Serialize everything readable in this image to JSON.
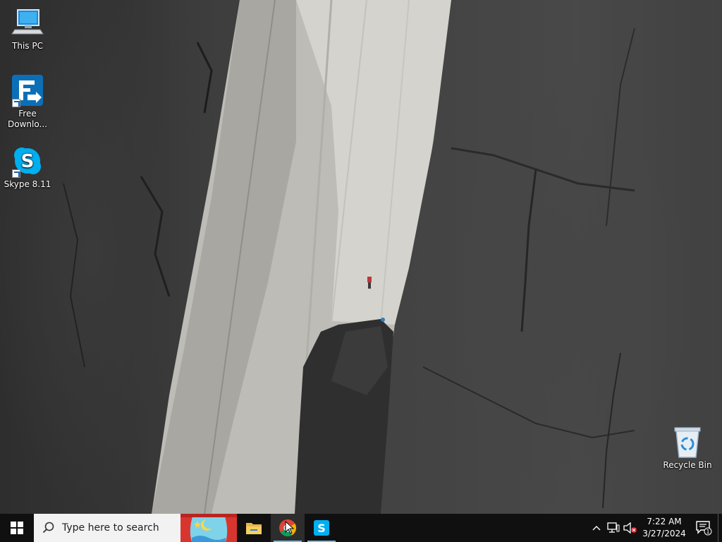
{
  "desktop": {
    "icons": [
      {
        "label": "This PC",
        "icon": "this-pc-icon"
      },
      {
        "label": "Free Downlo...",
        "label_line1": "Free",
        "label_line2": "Downlo...",
        "icon": "free-download-manager-icon"
      },
      {
        "label": "Skype 8.11",
        "icon": "skype-icon"
      },
      {
        "label": "Recycle Bin",
        "icon": "recycle-bin-icon"
      }
    ]
  },
  "taskbar": {
    "start_icon": "windows-start-icon",
    "search_placeholder": "Type here to search",
    "apps": [
      {
        "name": "Sketch book app",
        "icon": "theater-app-icon"
      },
      {
        "name": "File Explorer",
        "icon": "file-explorer-icon"
      },
      {
        "name": "Google Chrome",
        "icon": "chrome-icon"
      },
      {
        "name": "Skype",
        "icon": "skype-icon"
      }
    ],
    "tray": {
      "chevron": "show-hidden-icons",
      "network": "network-icon",
      "volume": "volume-muted-icon",
      "time": "7:22 AM",
      "date": "3/27/2024",
      "notification_count": "1"
    }
  },
  "colors": {
    "taskbar_bg": "#101010",
    "search_bg": "#f2f2f2",
    "accent": "#76b9ed",
    "skype_blue": "#00aff0"
  }
}
